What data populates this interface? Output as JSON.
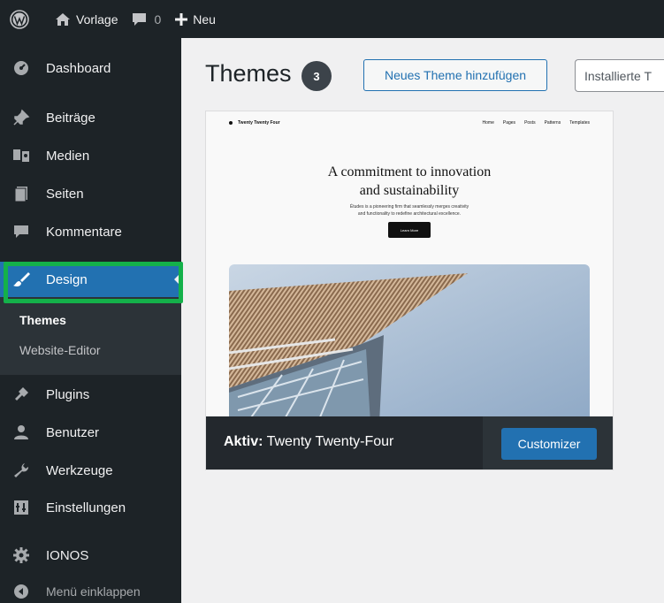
{
  "admin_bar": {
    "site_name": "Vorlage",
    "comments_count": "0",
    "new_label": "Neu"
  },
  "sidebar": {
    "items": [
      {
        "label": "Dashboard",
        "icon": "dashboard-icon"
      },
      {
        "label": "Beiträge",
        "icon": "pin-icon"
      },
      {
        "label": "Medien",
        "icon": "media-icon"
      },
      {
        "label": "Seiten",
        "icon": "page-icon"
      },
      {
        "label": "Kommentare",
        "icon": "comment-icon"
      },
      {
        "label": "Design",
        "icon": "brush-icon",
        "active": true
      },
      {
        "label": "Plugins",
        "icon": "plugin-icon"
      },
      {
        "label": "Benutzer",
        "icon": "user-icon"
      },
      {
        "label": "Werkzeuge",
        "icon": "wrench-icon"
      },
      {
        "label": "Einstellungen",
        "icon": "settings-icon"
      },
      {
        "label": "IONOS",
        "icon": "gear-icon"
      }
    ],
    "submenu": [
      {
        "label": "Themes",
        "current": true
      },
      {
        "label": "Website-Editor"
      }
    ],
    "collapse_label": "Menü einklappen"
  },
  "main": {
    "title": "Themes",
    "count": "3",
    "add_button": "Neues Theme hinzufügen",
    "search_placeholder": "Installierte Themes durchsuchen …"
  },
  "theme": {
    "active_prefix": "Aktiv:",
    "name": "Twenty Twenty-Four",
    "customize_label": "Customizer",
    "preview": {
      "site_title": "Twenty Twenty Four",
      "nav": [
        "Home",
        "Pages",
        "Posts",
        "Patterns",
        "Templates"
      ],
      "heading_line1": "A commitment to innovation",
      "heading_line2": "and sustainability",
      "subtext_line1": "Études is a pioneering firm that seamlessly merges creativity",
      "subtext_line2": "and functionality to redefine architectural excellence.",
      "cta": "Learn More"
    }
  },
  "colors": {
    "admin_bg": "#1d2327",
    "accent": "#2271b1",
    "highlight": "#14b14a"
  }
}
